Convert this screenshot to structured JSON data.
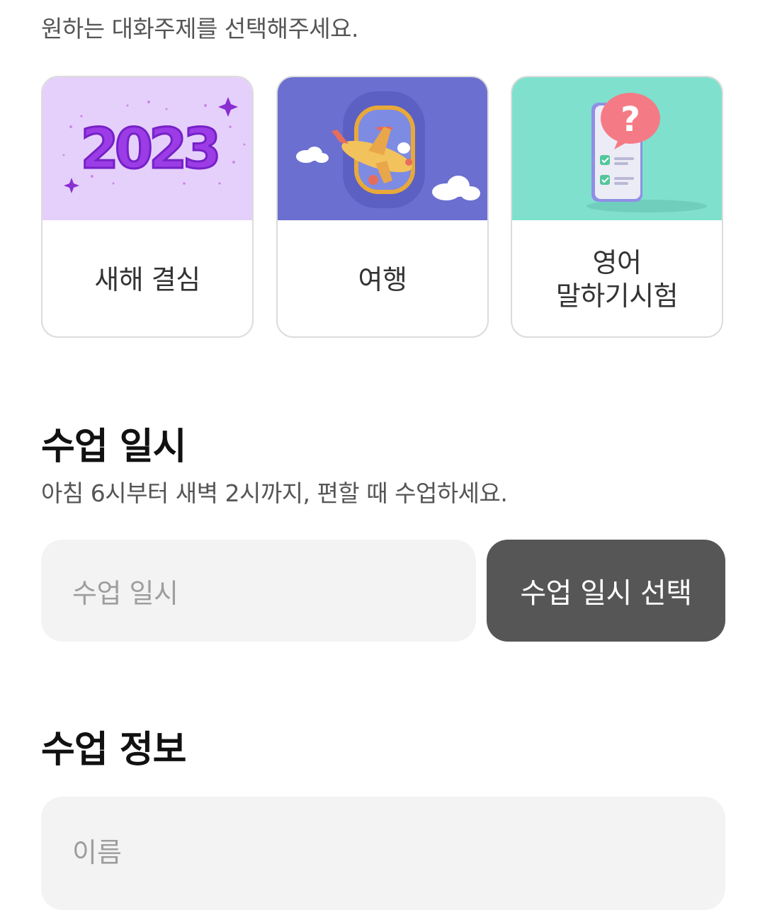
{
  "topic": {
    "hint": "원하는 대화주제를 선택해주세요.",
    "cards": [
      {
        "label": "새해 결심",
        "image_text": "2023",
        "color": "#e5d0fb"
      },
      {
        "label": "여행",
        "color": "#6b6fcf"
      },
      {
        "label": "영어\n말하기시험",
        "color": "#7fe0cd"
      }
    ]
  },
  "schedule": {
    "title": "수업 일시",
    "subtitle": "아침 6시부터 새벽 2시까지, 편할 때 수업하세요.",
    "field_placeholder": "수업 일시",
    "button_label": "수업 일시 선택"
  },
  "info": {
    "title": "수업 정보",
    "name_placeholder": "이름"
  },
  "colors": {
    "button_bg": "#565656",
    "field_bg": "#f3f3f3"
  }
}
